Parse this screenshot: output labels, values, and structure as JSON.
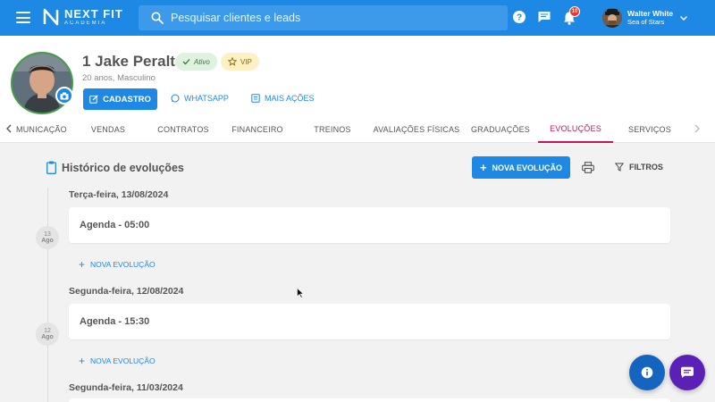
{
  "topbar": {
    "logo_main": "NEXT FIT",
    "logo_sub": "ACADEMIA",
    "search_placeholder": "Pesquisar clientes e leads",
    "notification_count": "10",
    "user_name": "Walter White",
    "user_org": "Sea of Stars",
    "icons": [
      "menu-icon",
      "search-icon",
      "help-icon",
      "chat-icon",
      "bell-icon",
      "chevron-down-icon"
    ]
  },
  "client": {
    "name": "1 Jake Peralta",
    "status": "Ativo",
    "tag": "VIP",
    "details": "20 anos, Masculino"
  },
  "actions": {
    "cadastro": "CADASTRO",
    "whatsapp": "WHATSAPP",
    "more": "MAIS AÇÕES"
  },
  "tabs": [
    {
      "label": "MUNICAÇÃO"
    },
    {
      "label": "VENDAS"
    },
    {
      "label": "CONTRATOS"
    },
    {
      "label": "FINANCEIRO"
    },
    {
      "label": "TREINOS"
    },
    {
      "label": "AVALIAÇÕES FÍSICAS"
    },
    {
      "label": "GRADUAÇÕES"
    },
    {
      "label": "EVOLUÇÕES",
      "active": true
    },
    {
      "label": "SERVIÇOS"
    }
  ],
  "section": {
    "title": "Histórico de evoluções",
    "new_button": "NOVA EVOLUÇÃO",
    "filter_button": "FILTROS"
  },
  "timeline": [
    {
      "heading": "Terça-feira, 13/08/2024",
      "day": "13",
      "month": "Ago",
      "entry": "Agenda - 05:00",
      "add_label": "NOVA EVOLUÇÃO"
    },
    {
      "heading": "Segunda-feira, 12/08/2024",
      "day": "12",
      "month": "Ago",
      "entry": "Agenda - 15:30",
      "add_label": "NOVA EVOLUÇÃO"
    },
    {
      "heading": "Segunda-feira, 11/03/2024"
    }
  ],
  "colors": {
    "primary": "#1e88e5",
    "active_tab": "#c2185b",
    "status_green": "#2e7d32",
    "chat_fab": "#5b21b6"
  }
}
